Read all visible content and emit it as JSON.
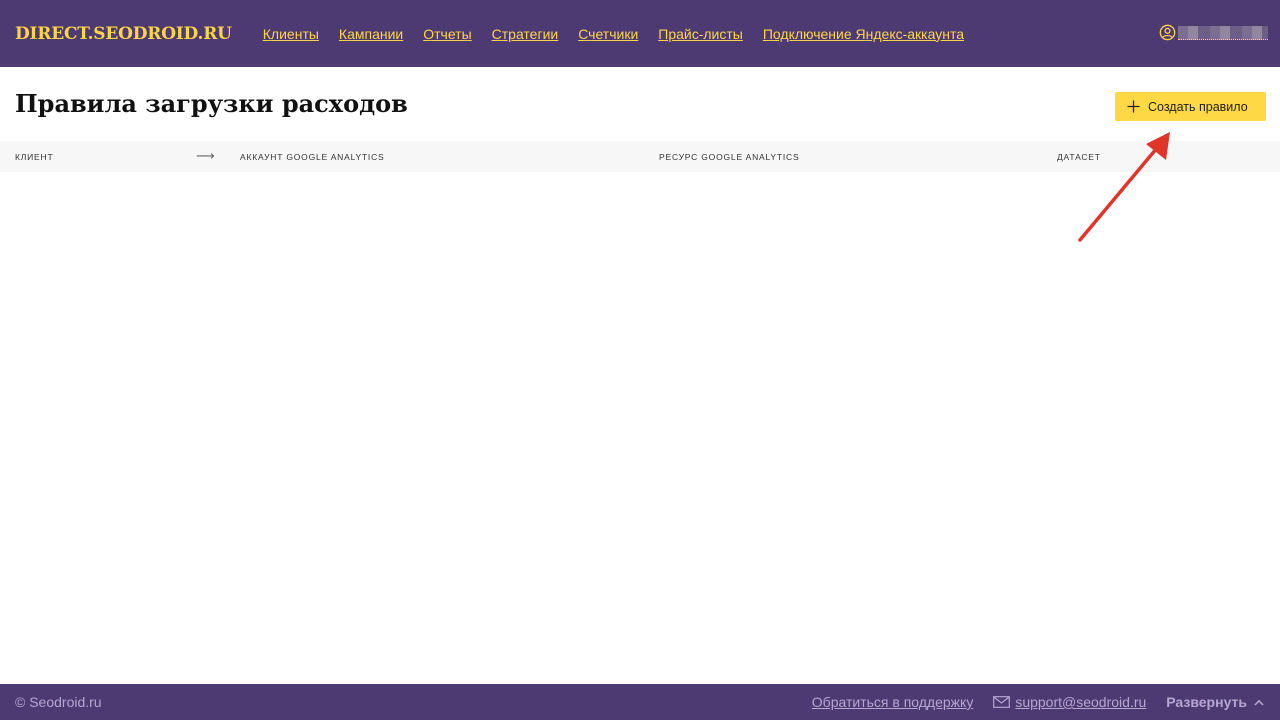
{
  "header": {
    "logo": "DIRECT.SEODROID.RU",
    "nav": [
      {
        "label": "Клиенты"
      },
      {
        "label": "Кампании"
      },
      {
        "label": "Отчеты"
      },
      {
        "label": "Стратегии"
      },
      {
        "label": "Счетчики"
      },
      {
        "label": "Прайс-листы"
      },
      {
        "label": "Подключение Яндекс-аккаунта"
      }
    ],
    "user_icon": "user-icon"
  },
  "main": {
    "title": "Правила загрузки расходов",
    "create_button": {
      "label": "Создать правило",
      "icon": "plus-icon"
    },
    "table": {
      "columns": [
        "Клиент",
        "Аккаунт Google Analytics",
        "Ресурс Google Analytics",
        "Датасет"
      ],
      "arrow": "⟶"
    }
  },
  "footer": {
    "copyright": "© Seodroid.ru",
    "support_link": "Обратиться в поддержку",
    "email": "support@seodroid.ru",
    "expand_label": "Развернуть"
  },
  "colors": {
    "header_bg": "#4d3a72",
    "accent_yellow": "#ffd546",
    "footer_text": "#b6a6d3",
    "annotation_red": "#e0352b"
  }
}
